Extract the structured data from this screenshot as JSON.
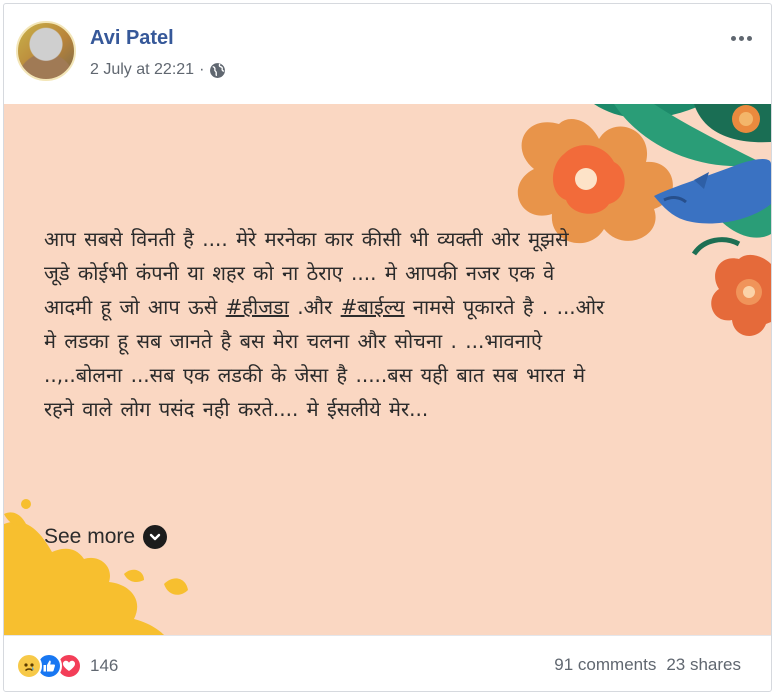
{
  "post": {
    "author": "Avi Patel",
    "timestamp": "2 July at 22:21",
    "separator": "·",
    "audience_icon": "globe-icon",
    "options_icon": "more-horizontal-icon",
    "text": {
      "line1": "आप सबसे विनती है .... मेरे मरनेका कार कीसी भी व्यक्ती ओर मूझसे",
      "line2": "जूडे कोईभी कंपनी या शहर को ना ठेराए .... मे आपकी नजर एक वे",
      "line3_pre": "आदमी हू जो आप ऊसे ",
      "hashtag1": "#हीजडा",
      "line3_mid": " .और ",
      "hashtag2": "#बाईल्य",
      "line3_post": " नामसे पूकारते है . ...ओर",
      "line4": "मे लडका हू सब जानते है बस मेरा चलना और सोचना . ...भावनाऐ",
      "line5": "..,..बोलना ...सब एक लडकी के जेसा है .....बस यही बात सब भारत मे",
      "line6": "रहने वाले लोग पसंद नही करते.... मे ईसलीये मेर..."
    },
    "see_more": "See more",
    "reactions": {
      "icons": [
        "sad-icon",
        "like-icon",
        "love-icon"
      ],
      "count": "146"
    },
    "comments": "91 comments",
    "shares": "23 shares"
  },
  "colors": {
    "author_link": "#365899",
    "image_background": "#fad7c2",
    "meta_text": "#606770"
  }
}
